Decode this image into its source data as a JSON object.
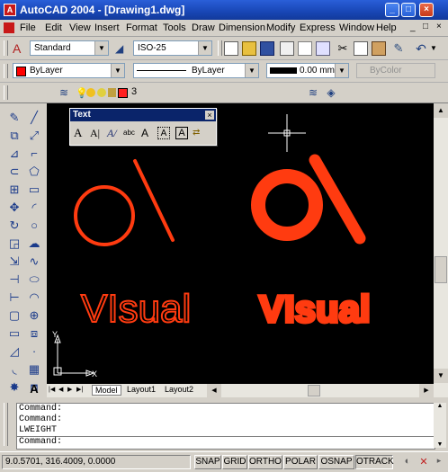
{
  "window": {
    "title": "AutoCAD 2004 - [Drawing1.dwg]"
  },
  "menu": [
    "File",
    "Edit",
    "View",
    "Insert",
    "Format",
    "Tools",
    "Draw",
    "Dimension",
    "Modify",
    "Express",
    "Window",
    "Help"
  ],
  "styles": {
    "text_style": "Standard",
    "dim_style": "ISO-25"
  },
  "properties": {
    "color": "ByLayer",
    "linetype": "ByLayer",
    "lineweight": "0.00 mm",
    "plotstyle": "ByColor"
  },
  "layer": {
    "current": "3"
  },
  "text_toolbar": {
    "title": "Text"
  },
  "drawing": {
    "text_normal": "VIsual",
    "text_bold": "VIsual"
  },
  "axis": {
    "y_label": "Y",
    "x_label": "X"
  },
  "tabs": [
    "Model",
    "Layout1",
    "Layout2"
  ],
  "command_lines": [
    "Command:",
    "Command:",
    "LWEIGHT",
    "Command:"
  ],
  "status": {
    "coords": "9.0.5701, 316.4009, 0.0000",
    "toggles": [
      "SNAP",
      "GRID",
      "ORTHO",
      "POLAR",
      "OSNAP",
      "OTRACK"
    ]
  },
  "colors": {
    "drawing_red": "#ff3b10",
    "canvas": "#000000",
    "titlebar": "#1846b5"
  },
  "icons": [
    "autocad-app-icon",
    "minimize-icon",
    "maximize-icon",
    "close-icon",
    "crosshair-cursor",
    "ucs-icon"
  ]
}
